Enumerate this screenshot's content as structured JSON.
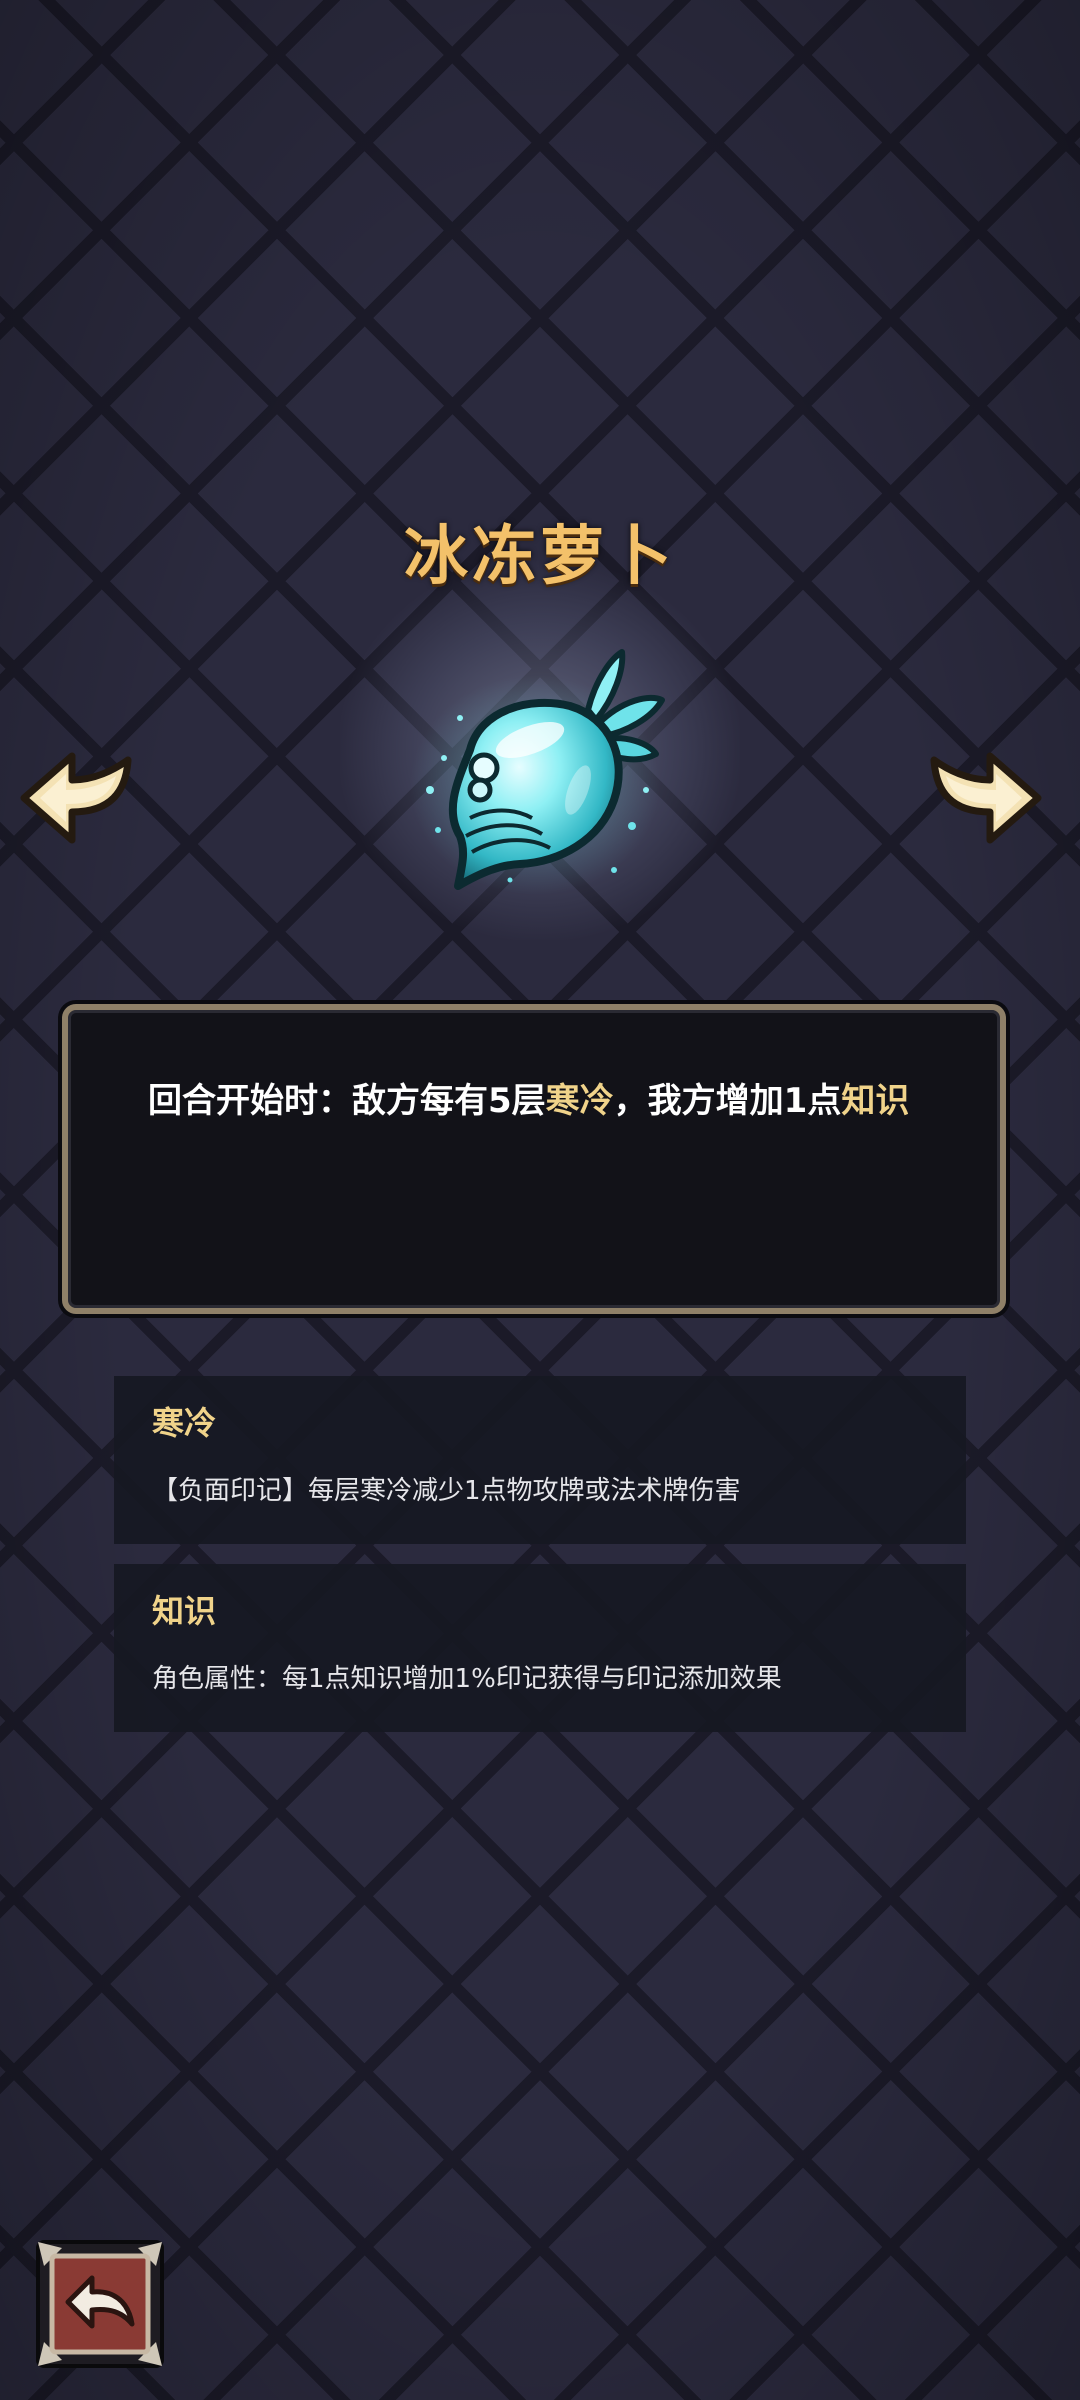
{
  "item": {
    "name": "冰冻萝卜",
    "effect_prefix": "回合开始时：敌方每有5层",
    "effect_kw1": "寒冷",
    "effect_mid": "，我方增加1点",
    "effect_kw2": "知识"
  },
  "terms": [
    {
      "title": "寒冷",
      "body": "【负面印记】每层寒冷减少1点物攻牌或法术牌伤害"
    },
    {
      "title": "知识",
      "body": "角色属性：每1点知识增加1%印记获得与印记添加效果"
    }
  ],
  "icons": {
    "prev": "arrow-left-icon",
    "next": "arrow-right-icon",
    "back": "return-arrow-icon",
    "item": "frozen-radish-icon"
  },
  "colors": {
    "title": "#f3c16a",
    "keyword": "#f0d38a",
    "frame": "#8f8068",
    "ice": "#6fe3ea",
    "back_button": "#8a3a34"
  }
}
